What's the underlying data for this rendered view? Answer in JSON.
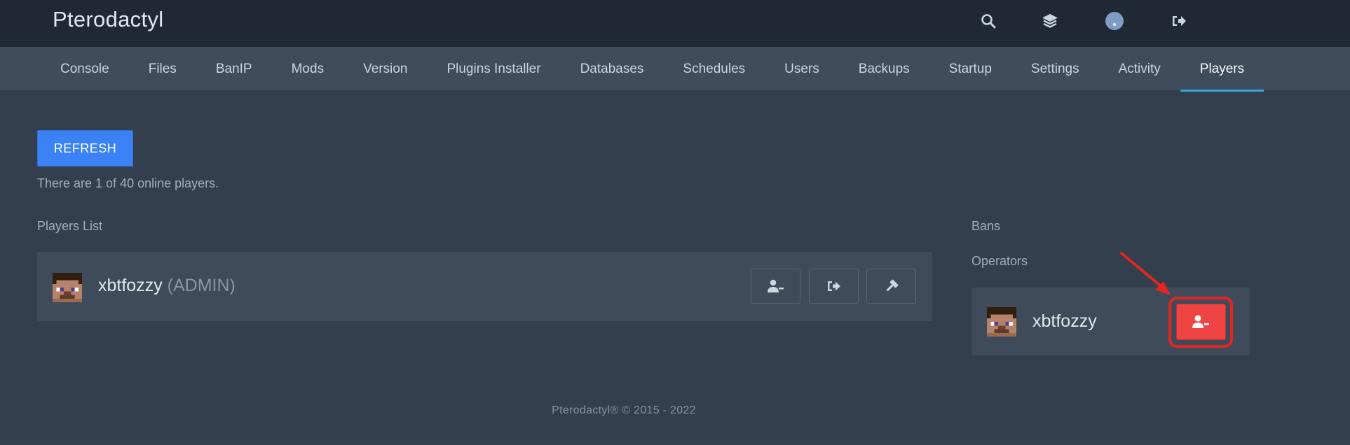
{
  "app": {
    "brand": "Pterodactyl"
  },
  "topbar": {
    "icons": [
      "search-icon",
      "layers-icon",
      "avatar-icon",
      "logout-icon"
    ]
  },
  "nav": {
    "tabs": [
      {
        "label": "Console"
      },
      {
        "label": "Files"
      },
      {
        "label": "BanIP"
      },
      {
        "label": "Mods"
      },
      {
        "label": "Version"
      },
      {
        "label": "Plugins Installer"
      },
      {
        "label": "Databases"
      },
      {
        "label": "Schedules"
      },
      {
        "label": "Users"
      },
      {
        "label": "Backups"
      },
      {
        "label": "Startup"
      },
      {
        "label": "Settings"
      },
      {
        "label": "Activity"
      },
      {
        "label": "Players"
      }
    ],
    "active": "Players"
  },
  "main": {
    "refresh_label": "REFRESH",
    "online_text": "There are 1 of 40 online players.",
    "players_list_label": "Players List",
    "bans_label": "Bans",
    "operators_label": "Operators",
    "players": [
      {
        "name": "xbtfozzy",
        "role": "(ADMIN)",
        "actions": [
          "deop-icon",
          "kick-icon",
          "ban-hammer-icon"
        ]
      }
    ],
    "operators": [
      {
        "name": "xbtfozzy",
        "action": "deop-icon"
      }
    ]
  },
  "colors": {
    "accent": "#3b82f6",
    "danger": "#ef4444",
    "annotation": "#e3261f",
    "active_tab_underline": "#38a3d8"
  },
  "footer": {
    "text": "Pterodactyl® © 2015 - 2022"
  }
}
